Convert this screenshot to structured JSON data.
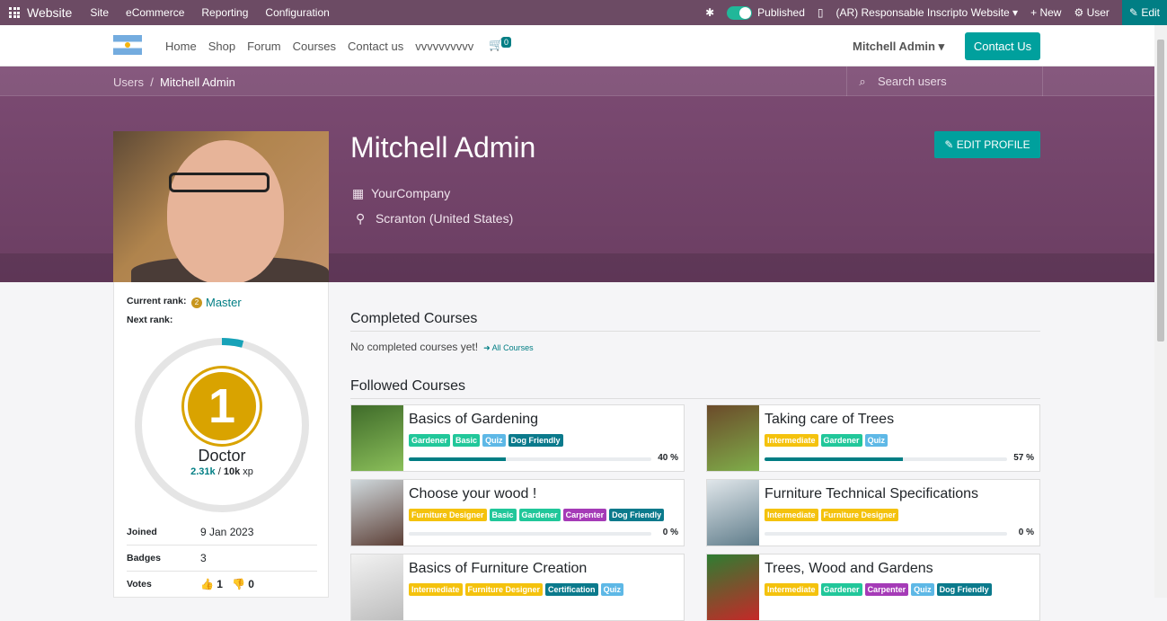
{
  "topbar": {
    "app_name": "Website",
    "menu": [
      "Site",
      "eCommerce",
      "Reporting",
      "Configuration"
    ],
    "published_label": "Published",
    "website_label": "(AR) Responsable Inscripto Website",
    "new_label": "New",
    "user_label": "User",
    "edit_label": "Edit"
  },
  "navbar": {
    "links": [
      "Home",
      "Shop",
      "Forum",
      "Courses",
      "Contact us",
      "vvvvvvvvvv"
    ],
    "cart_count": "0",
    "user_name": "Mitchell Admin",
    "contact_label": "Contact Us"
  },
  "breadcrumb": {
    "parent": "Users",
    "separator": "/",
    "current": "Mitchell Admin"
  },
  "search": {
    "placeholder": "Search users"
  },
  "profile": {
    "name": "Mitchell Admin",
    "company": "YourCompany",
    "location": "Scranton (United States)",
    "edit_label": "EDIT PROFILE"
  },
  "rank": {
    "current_label": "Current rank:",
    "current_value": "Master",
    "next_label": "Next rank:",
    "badge_number": "1",
    "badge_name": "Doctor",
    "xp_current": "2.31k",
    "xp_separator": " / ",
    "xp_total": "10k",
    "xp_unit": " xp",
    "progress": 0.04
  },
  "stats": {
    "joined_label": "Joined",
    "joined_value": "9 Jan 2023",
    "badges_label": "Badges",
    "badges_value": "3",
    "votes_label": "Votes",
    "votes_up": "1",
    "votes_down": "0"
  },
  "completed": {
    "title": "Completed Courses",
    "empty": "No completed courses yet!",
    "link": "All Courses"
  },
  "followed": {
    "title": "Followed Courses",
    "courses": [
      {
        "title": "Basics of Gardening",
        "tags": [
          [
            "Gardener",
            "#21c79a"
          ],
          [
            "Basic",
            "#21c79a"
          ],
          [
            "Quiz",
            "#5eb8e6"
          ],
          [
            "Dog Friendly",
            "#0b7a8c"
          ]
        ],
        "progress": "40 %",
        "fill": 0.4
      },
      {
        "title": "Taking care of Trees",
        "tags": [
          [
            "Intermediate",
            "#f4c20d"
          ],
          [
            "Gardener",
            "#21c79a"
          ],
          [
            "Quiz",
            "#5eb8e6"
          ]
        ],
        "progress": "57 %",
        "fill": 0.57
      },
      {
        "title": "Choose your wood !",
        "tags": [
          [
            "Furniture Designer",
            "#f4c20d"
          ],
          [
            "Basic",
            "#21c79a"
          ],
          [
            "Gardener",
            "#21c79a"
          ],
          [
            "Carpenter",
            "#a53bb7"
          ],
          [
            "Dog Friendly",
            "#0b7a8c"
          ]
        ],
        "progress": "0 %",
        "fill": 0
      },
      {
        "title": "Furniture Technical Specifications",
        "tags": [
          [
            "Intermediate",
            "#f4c20d"
          ],
          [
            "Furniture Designer",
            "#f4c20d"
          ]
        ],
        "progress": "0 %",
        "fill": 0
      },
      {
        "title": "Basics of Furniture Creation",
        "tags": [
          [
            "Intermediate",
            "#f4c20d"
          ],
          [
            "Furniture Designer",
            "#f4c20d"
          ],
          [
            "Certification",
            "#0b7a8c"
          ],
          [
            "Quiz",
            "#5eb8e6"
          ]
        ],
        "progress": "",
        "fill": 0
      },
      {
        "title": "Trees, Wood and Gardens",
        "tags": [
          [
            "Intermediate",
            "#f4c20d"
          ],
          [
            "Gardener",
            "#21c79a"
          ],
          [
            "Carpenter",
            "#a53bb7"
          ],
          [
            "Quiz",
            "#5eb8e6"
          ],
          [
            "Dog Friendly",
            "#0b7a8c"
          ]
        ],
        "progress": "",
        "fill": 0
      }
    ]
  }
}
